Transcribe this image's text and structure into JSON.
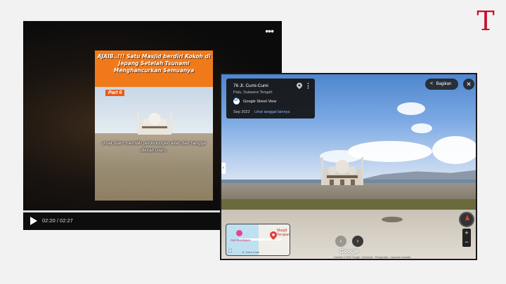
{
  "logo": {
    "text": "T"
  },
  "video": {
    "menu_label": "•••",
    "banner_text": "AJAIB..!!! Satu Masjid berdiri Kokoh di Jepang   Setelah Tsunami Menghancurkan Semuanya",
    "part_label": "Part 6",
    "caption": "umat islam memiliki perlindungan allah dan bangga dikitab islam.",
    "time": "02:20 / 02:27",
    "progress": 0.95
  },
  "street_view": {
    "address": "76 Jl. Cumi-Cumi",
    "city": "Palu, Sulawesi Tengah",
    "source": "Google Street View",
    "date": "Sep 2022",
    "more_dates": "Lihat tanggal lainnya",
    "share_label": "Bagikan",
    "close_label": "✕",
    "collapse_label": "‹",
    "prev_label": "‹",
    "next_label": "›",
    "brand": "Google",
    "copyright": "Gambar © 2024 Google · Indonesia · Persyaratan · Laporkan masalah",
    "zoom_in": "+",
    "zoom_out": "−",
    "minimap": {
      "pin_label": "Masjid Terapung",
      "poi_label": "Ace Hardware",
      "road_label": "Jl. Cumi-Cumi",
      "expand_label": "⛶"
    }
  },
  "colors": {
    "logo_red": "#c8102e",
    "banner_orange": "#f07a1a"
  }
}
